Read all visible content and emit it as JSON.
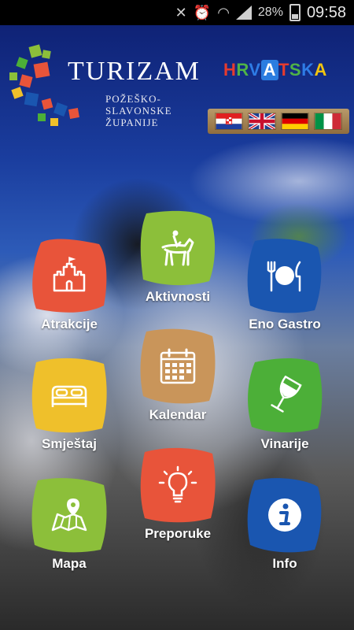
{
  "status_bar": {
    "battery_percent": "28%",
    "time": "09:58",
    "icons": [
      "mute-icon",
      "alarm-icon",
      "wifi-icon",
      "signal-icon",
      "battery-icon"
    ]
  },
  "header": {
    "title": "TURIZAM",
    "subtitle_lines": [
      "POŽEŠKO-",
      "SLAVONSKE",
      "ŽUPANIJE"
    ],
    "partner_logo": "HRVATSKA"
  },
  "languages": [
    {
      "code": "hr",
      "name": "Croatian"
    },
    {
      "code": "en",
      "name": "English"
    },
    {
      "code": "de",
      "name": "German"
    },
    {
      "code": "it",
      "name": "Italian"
    }
  ],
  "menu": {
    "atrakcije": {
      "label": "Atrakcije",
      "color": "#e8543a",
      "icon": "castle-icon"
    },
    "aktivnosti": {
      "label": "Aktivnosti",
      "color": "#8cbf3a",
      "icon": "horse-rider-icon"
    },
    "eno_gastro": {
      "label": "Eno Gastro",
      "color": "#1a56b0",
      "icon": "dining-icon"
    },
    "smjestaj": {
      "label": "Smještaj",
      "color": "#efc02b",
      "icon": "bed-icon"
    },
    "kalendar": {
      "label": "Kalendar",
      "color": "#c9955a",
      "icon": "calendar-icon"
    },
    "vinarije": {
      "label": "Vinarije",
      "color": "#4caf38",
      "icon": "wine-glass-icon"
    },
    "mapa": {
      "label": "Mapa",
      "color": "#8cbf3a",
      "icon": "map-icon"
    },
    "preporuke": {
      "label": "Preporuke",
      "color": "#e8543a",
      "icon": "lightbulb-icon"
    },
    "info": {
      "label": "Info",
      "color": "#1a56b0",
      "icon": "info-icon"
    }
  }
}
